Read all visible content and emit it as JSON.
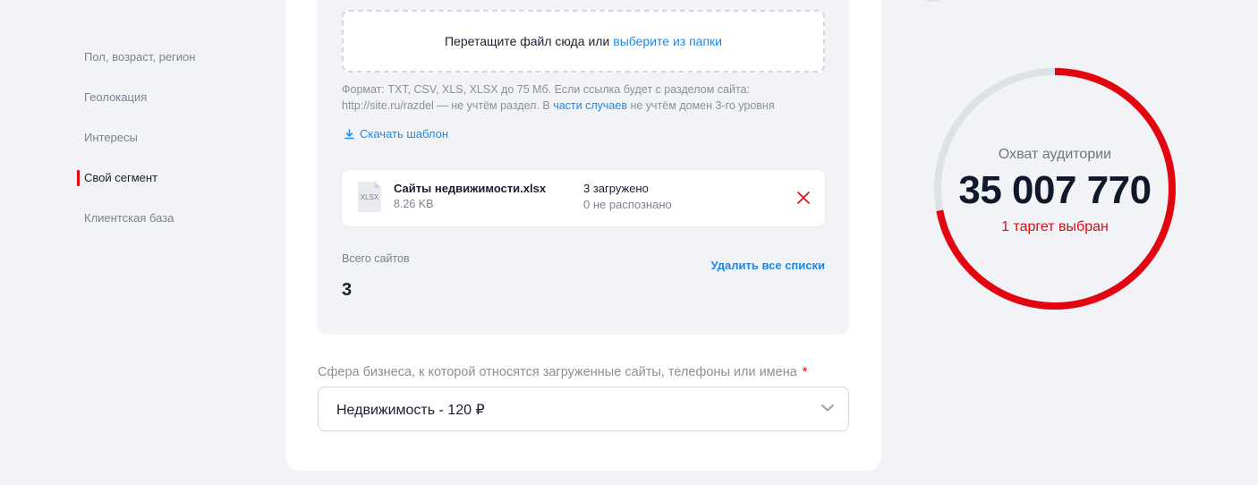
{
  "sidebar": {
    "items": [
      {
        "label": "Пол, возраст, регион"
      },
      {
        "label": "Геолокация"
      },
      {
        "label": "Интересы"
      },
      {
        "label": "Свой сегмент"
      },
      {
        "label": "Клиентская база"
      }
    ]
  },
  "upload": {
    "drop_text": "Перетащите файл сюда или",
    "drop_link": "выберите из папки",
    "hint_line1": "Формат: TXT, CSV, XLS, XLSX до 75 Мб. Если ссылка будет с разделом сайта:",
    "hint_line2_a": "http://site.ru/razdel — не учтём раздел. В",
    "hint_link": "части случаев",
    "hint_line2_b": "не учтём домен 3-го уровня",
    "download_template": "Скачать шаблон"
  },
  "file": {
    "icon_text": "XLSX",
    "name": "Сайты недвижимости.xlsx",
    "size": "8.26 KB",
    "loaded": "3 загружено",
    "not_recognized": "0 не распознано"
  },
  "totals": {
    "label": "Всего сайтов",
    "value": "3",
    "delete_all": "Удалить все списки"
  },
  "business": {
    "label": "Сфера бизнеса, к которой относятся загруженные сайты, телефоны или имена",
    "required_mark": "*",
    "selected": "Недвижимость - 120 ₽"
  },
  "audience": {
    "title": "Охват аудитории",
    "value": "35 007 770",
    "targets": "1 таргет выбран",
    "fill_fraction": 0.72,
    "colors": {
      "fill": "#e30611",
      "track": "#dde1e8"
    }
  }
}
